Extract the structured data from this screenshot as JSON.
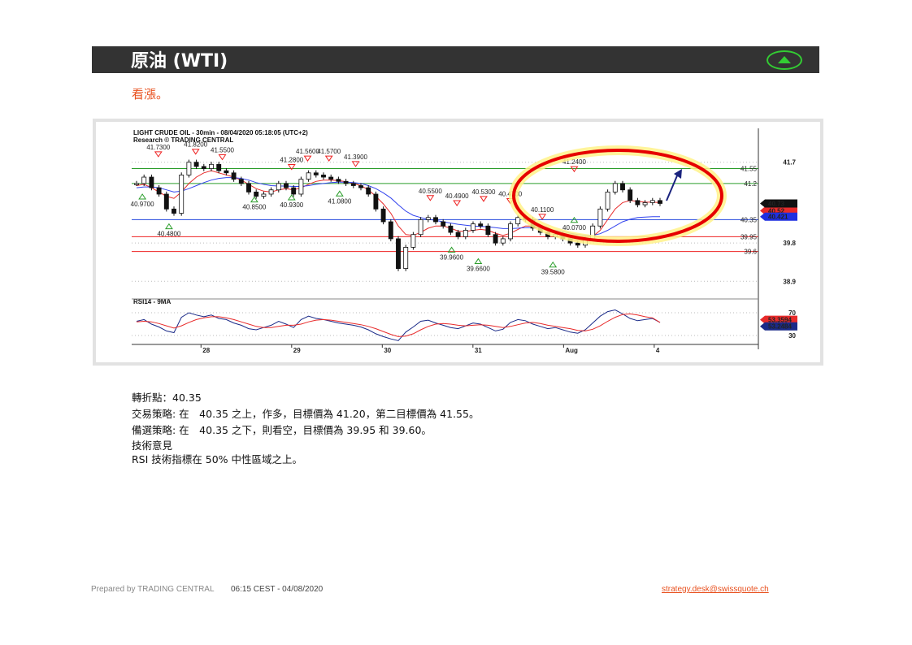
{
  "header": {
    "title": "原油 (WTI)",
    "trend": "up"
  },
  "outlook": "看漲。",
  "chart_data": {
    "type": "candlestick",
    "title": "LIGHT CRUDE OIL - 30min - 08/04/2020 05:18:05 (UTC+2)",
    "subtitle": "Research © TRADING CENTRAL",
    "x_ticks": [
      "28",
      "29",
      "30",
      "31",
      "Aug",
      "4"
    ],
    "y_ticks": [
      41.7,
      39.8,
      38.9
    ],
    "ylim": [
      38.6,
      42.0
    ],
    "grid": "dotted",
    "levels": [
      {
        "label": "41.55",
        "value": 41.55,
        "color": "#2a9d2a"
      },
      {
        "label": "41.2",
        "value": 41.2,
        "color": "#2a9d2a"
      },
      {
        "label": "40.35",
        "value": 40.35,
        "color": "#2244dd"
      },
      {
        "label": "39.95",
        "value": 39.95,
        "color": "#ee2222"
      },
      {
        "label": "39.6",
        "value": 39.6,
        "color": "#ee2222"
      }
    ],
    "price_tags": [
      {
        "text": "40.52",
        "value": 40.56,
        "color": "#e82a2a"
      },
      {
        "text": "40.73",
        "value": 40.73,
        "color": "#111111"
      },
      {
        "text": "40.421",
        "value": 40.42,
        "color": "#1f2fe0"
      }
    ],
    "swing_labels": [
      {
        "text": "41.7300",
        "x": 0.05,
        "value": 41.85,
        "dir": "high"
      },
      {
        "text": "41.8200",
        "x": 0.12,
        "value": 41.91,
        "dir": "high"
      },
      {
        "text": "41.5500",
        "x": 0.17,
        "value": 41.78,
        "dir": "high"
      },
      {
        "text": "41.2800",
        "x": 0.3,
        "value": 41.55,
        "dir": "high"
      },
      {
        "text": "41.5600",
        "x": 0.33,
        "value": 41.75,
        "dir": "high"
      },
      {
        "text": "41.5700",
        "x": 0.37,
        "value": 41.75,
        "dir": "high"
      },
      {
        "text": "41.3900",
        "x": 0.42,
        "value": 41.62,
        "dir": "high"
      },
      {
        "text": "40.9700",
        "x": 0.02,
        "value": 40.95,
        "dir": "low"
      },
      {
        "text": "40.4800",
        "x": 0.07,
        "value": 40.25,
        "dir": "low"
      },
      {
        "text": "40.8500",
        "x": 0.23,
        "value": 40.88,
        "dir": "low"
      },
      {
        "text": "40.9300",
        "x": 0.3,
        "value": 40.93,
        "dir": "low"
      },
      {
        "text": "41.0800",
        "x": 0.39,
        "value": 41.02,
        "dir": "low"
      },
      {
        "text": "40.5500",
        "x": 0.56,
        "value": 40.82,
        "dir": "high"
      },
      {
        "text": "40.4900",
        "x": 0.61,
        "value": 40.7,
        "dir": "high"
      },
      {
        "text": "40.5300",
        "x": 0.66,
        "value": 40.8,
        "dir": "high"
      },
      {
        "text": "40.4700",
        "x": 0.71,
        "value": 40.75,
        "dir": "high"
      },
      {
        "text": "40.1100",
        "x": 0.77,
        "value": 40.38,
        "dir": "high"
      },
      {
        "text": "41.2400",
        "x": 0.83,
        "value": 41.5,
        "dir": "high"
      },
      {
        "text": "39.9600",
        "x": 0.6,
        "value": 39.7,
        "dir": "low"
      },
      {
        "text": "39.6600",
        "x": 0.65,
        "value": 39.43,
        "dir": "low"
      },
      {
        "text": "39.5800",
        "x": 0.79,
        "value": 39.35,
        "dir": "low"
      },
      {
        "text": "40.0700",
        "x": 0.83,
        "value": 40.4,
        "dir": "low"
      }
    ],
    "series": [
      {
        "name": "Price",
        "color": "#111111",
        "values": [
          41.2,
          41.35,
          41.1,
          40.95,
          40.6,
          40.5,
          41.4,
          41.7,
          41.6,
          41.55,
          41.65,
          41.5,
          41.45,
          41.3,
          41.2,
          41.0,
          40.9,
          40.95,
          41.05,
          41.2,
          41.1,
          40.95,
          41.3,
          41.45,
          41.4,
          41.35,
          41.3,
          41.25,
          41.2,
          41.15,
          41.1,
          40.95,
          40.6,
          40.3,
          39.9,
          39.2,
          39.7,
          40.0,
          40.35,
          40.4,
          40.3,
          40.2,
          40.05,
          39.95,
          40.1,
          40.25,
          40.2,
          40.0,
          39.8,
          39.9,
          40.25,
          40.4,
          40.35,
          40.15,
          40.05,
          39.95,
          40.0,
          39.9,
          39.8,
          39.75,
          39.9,
          40.2,
          40.6,
          41.0,
          41.2,
          41.05,
          40.8,
          40.7,
          40.75,
          40.8,
          40.73
        ]
      },
      {
        "name": "MA1",
        "color": "#e82a2a",
        "values": [
          41.15,
          41.18,
          41.1,
          41.0,
          40.9,
          40.85,
          41.0,
          41.2,
          41.35,
          41.45,
          41.5,
          41.45,
          41.4,
          41.35,
          41.28,
          41.18,
          41.08,
          41.02,
          41.0,
          41.05,
          41.08,
          41.05,
          41.1,
          41.18,
          41.25,
          41.28,
          41.28,
          41.27,
          41.24,
          41.2,
          41.15,
          41.05,
          40.9,
          40.72,
          40.5,
          40.2,
          40.0,
          39.98,
          40.05,
          40.15,
          40.2,
          40.2,
          40.15,
          40.08,
          40.07,
          40.1,
          40.12,
          40.1,
          40.03,
          39.98,
          40.03,
          40.12,
          40.2,
          40.2,
          40.15,
          40.08,
          40.04,
          39.98,
          39.9,
          39.85,
          39.85,
          39.95,
          40.1,
          40.35,
          40.6,
          40.75,
          40.8,
          40.78,
          40.76,
          40.76,
          40.75
        ]
      },
      {
        "name": "MA2",
        "color": "#3344ee",
        "values": [
          41.1,
          41.12,
          41.12,
          41.1,
          41.05,
          41.0,
          41.02,
          41.08,
          41.15,
          41.22,
          41.28,
          41.32,
          41.34,
          41.34,
          41.32,
          41.28,
          41.22,
          41.18,
          41.15,
          41.14,
          41.14,
          41.13,
          41.13,
          41.15,
          41.18,
          41.2,
          41.22,
          41.23,
          41.23,
          41.22,
          41.2,
          41.15,
          41.08,
          40.98,
          40.86,
          40.7,
          40.55,
          40.45,
          40.4,
          40.36,
          40.33,
          40.3,
          40.27,
          40.24,
          40.22,
          40.2,
          40.19,
          40.18,
          40.16,
          40.14,
          40.14,
          40.15,
          40.16,
          40.16,
          40.15,
          40.13,
          40.1,
          40.07,
          40.03,
          40.0,
          39.98,
          39.98,
          40.02,
          40.1,
          40.2,
          40.3,
          40.36,
          40.4,
          40.41,
          40.42,
          40.42
        ]
      }
    ],
    "rsi_panel": {
      "title": "RSI14 - 9MA",
      "y_ticks": [
        70,
        30
      ],
      "ylim": [
        20,
        80
      ],
      "tags": [
        {
          "text": "53.3594",
          "value": 53.36,
          "color": "#e82a2a"
        },
        {
          "text": "53.2484",
          "value": 53.25,
          "color": "#1a2a88"
        }
      ],
      "series": [
        {
          "name": "RSI14",
          "color": "#1a2a88",
          "values": [
            55,
            58,
            50,
            45,
            38,
            35,
            62,
            70,
            66,
            63,
            66,
            60,
            58,
            52,
            48,
            42,
            40,
            44,
            48,
            55,
            50,
            44,
            58,
            64,
            60,
            58,
            55,
            52,
            50,
            48,
            45,
            40,
            33,
            28,
            24,
            21,
            36,
            45,
            55,
            57,
            52,
            48,
            44,
            42,
            47,
            52,
            50,
            44,
            38,
            41,
            53,
            58,
            56,
            50,
            46,
            42,
            44,
            40,
            36,
            34,
            40,
            52,
            64,
            72,
            75,
            68,
            60,
            56,
            58,
            60,
            53
          ]
        },
        {
          "name": "9MA",
          "color": "#e82a2a",
          "values": [
            54,
            55,
            54,
            51,
            47,
            43,
            47,
            53,
            58,
            61,
            63,
            63,
            61,
            58,
            54,
            50,
            46,
            44,
            44,
            46,
            48,
            48,
            50,
            54,
            57,
            58,
            57,
            55,
            53,
            51,
            49,
            46,
            42,
            37,
            32,
            28,
            29,
            33,
            40,
            46,
            50,
            51,
            50,
            48,
            47,
            48,
            49,
            48,
            46,
            44,
            46,
            49,
            52,
            53,
            51,
            48,
            46,
            44,
            42,
            39,
            38,
            41,
            47,
            55,
            62,
            67,
            68,
            66,
            63,
            61,
            53
          ]
        }
      ]
    },
    "annotations": {
      "highlight": "ellipse",
      "arrow": "up"
    }
  },
  "notes": {
    "pivot": "轉折點：40.35",
    "strategy": "交易策略: 在　40.35 之上，作多，目標價為 41.20，第二目標價為 41.55。",
    "alternative": "備選策略: 在　40.35 之下，則看空，目標價為 39.95 和 39.60。",
    "comment_title": "技術意見",
    "comment": "RSI 技術指標在 50% 中性區域之上。"
  },
  "footer": {
    "prepared_by": "Prepared by TRADING CENTRAL",
    "timestamp": "06:15 CEST - 04/08/2020",
    "email": "strategy.desk@swissquote.ch"
  }
}
